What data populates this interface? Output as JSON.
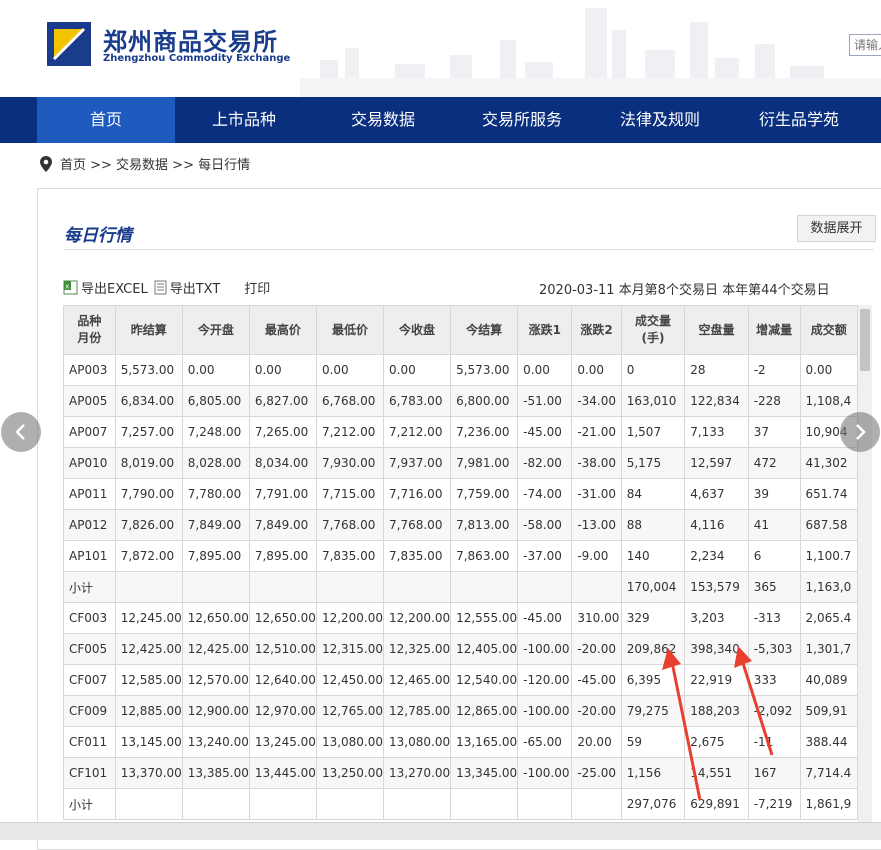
{
  "header": {
    "logo_cn": "郑州商品交易所",
    "logo_en": "Zhengzhou Commodity Exchange",
    "search_placeholder": "请输入"
  },
  "nav": [
    "首页",
    "上市品种",
    "交易数据",
    "交易所服务",
    "法律及规则",
    "衍生品学苑"
  ],
  "breadcrumb": "首页 >> 交易数据 >> 每日行情",
  "page_title": "每日行情",
  "expand_button": "数据展开",
  "toolbar": {
    "export_excel": "导出EXCEL",
    "export_txt": "导出TXT",
    "print": "打印"
  },
  "trade_info": "2020-03-11   本月第8个交易日   本年第44个交易日",
  "table": {
    "headers": [
      "品种月份",
      "昨结算",
      "今开盘",
      "最高价",
      "最低价",
      "今收盘",
      "今结算",
      "涨跌1",
      "涨跌2",
      "成交量(手)",
      "空盘量",
      "增减量",
      "成交额"
    ],
    "rows": [
      [
        "AP003",
        "5,573.00",
        "0.00",
        "0.00",
        "0.00",
        "0.00",
        "5,573.00",
        "0.00",
        "0.00",
        "0",
        "28",
        "-2",
        "0.00"
      ],
      [
        "AP005",
        "6,834.00",
        "6,805.00",
        "6,827.00",
        "6,768.00",
        "6,783.00",
        "6,800.00",
        "-51.00",
        "-34.00",
        "163,010",
        "122,834",
        "-228",
        "1,108,4"
      ],
      [
        "AP007",
        "7,257.00",
        "7,248.00",
        "7,265.00",
        "7,212.00",
        "7,212.00",
        "7,236.00",
        "-45.00",
        "-21.00",
        "1,507",
        "7,133",
        "37",
        "10,904"
      ],
      [
        "AP010",
        "8,019.00",
        "8,028.00",
        "8,034.00",
        "7,930.00",
        "7,937.00",
        "7,981.00",
        "-82.00",
        "-38.00",
        "5,175",
        "12,597",
        "472",
        "41,302"
      ],
      [
        "AP011",
        "7,790.00",
        "7,780.00",
        "7,791.00",
        "7,715.00",
        "7,716.00",
        "7,759.00",
        "-74.00",
        "-31.00",
        "84",
        "4,637",
        "39",
        "651.74"
      ],
      [
        "AP012",
        "7,826.00",
        "7,849.00",
        "7,849.00",
        "7,768.00",
        "7,768.00",
        "7,813.00",
        "-58.00",
        "-13.00",
        "88",
        "4,116",
        "41",
        "687.58"
      ],
      [
        "AP101",
        "7,872.00",
        "7,895.00",
        "7,895.00",
        "7,835.00",
        "7,835.00",
        "7,863.00",
        "-37.00",
        "-9.00",
        "140",
        "2,234",
        "6",
        "1,100.7"
      ],
      [
        "小计",
        "",
        "",
        "",
        "",
        "",
        "",
        "",
        "",
        "170,004",
        "153,579",
        "365",
        "1,163,0"
      ],
      [
        "CF003",
        "12,245.00",
        "12,650.00",
        "12,650.00",
        "12,200.00",
        "12,200.00",
        "12,555.00",
        "-45.00",
        "310.00",
        "329",
        "3,203",
        "-313",
        "2,065.4"
      ],
      [
        "CF005",
        "12,425.00",
        "12,425.00",
        "12,510.00",
        "12,315.00",
        "12,325.00",
        "12,405.00",
        "-100.00",
        "-20.00",
        "209,862",
        "398,340",
        "-5,303",
        "1,301,7"
      ],
      [
        "CF007",
        "12,585.00",
        "12,570.00",
        "12,640.00",
        "12,450.00",
        "12,465.00",
        "12,540.00",
        "-120.00",
        "-45.00",
        "6,395",
        "22,919",
        "333",
        "40,089"
      ],
      [
        "CF009",
        "12,885.00",
        "12,900.00",
        "12,970.00",
        "12,765.00",
        "12,785.00",
        "12,865.00",
        "-100.00",
        "-20.00",
        "79,275",
        "188,203",
        "-2,092",
        "509,91"
      ],
      [
        "CF011",
        "13,145.00",
        "13,240.00",
        "13,245.00",
        "13,080.00",
        "13,080.00",
        "13,165.00",
        "-65.00",
        "20.00",
        "59",
        "2,675",
        "-11",
        "388.44"
      ],
      [
        "CF101",
        "13,370.00",
        "13,385.00",
        "13,445.00",
        "13,250.00",
        "13,270.00",
        "13,345.00",
        "-100.00",
        "-25.00",
        "1,156",
        "14,551",
        "167",
        "7,714.4"
      ],
      [
        "小计",
        "",
        "",
        "",
        "",
        "",
        "",
        "",
        "",
        "297,076",
        "629,891",
        "-7,219",
        "1,861,9"
      ]
    ]
  },
  "colors": {
    "nav_bg": "#0a2f7e",
    "nav_active": "#1f5bbf",
    "brand": "#1a3c8c",
    "arrow": "#e8402f"
  }
}
